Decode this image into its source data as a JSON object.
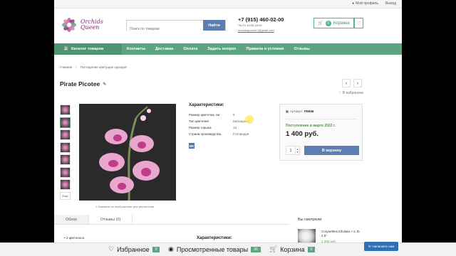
{
  "topbar": {
    "login": "Мой профиль",
    "exit": "Выход"
  },
  "logo": {
    "line1": "Orchids",
    "line2": "Queen"
  },
  "search": {
    "placeholder": "Поиск по товарам",
    "button": "Найти"
  },
  "contacts": {
    "phone": "+7 (915) 460-02-00",
    "hours": "Пн-Пт 10:00-18:00",
    "email": "orchidsqueen21@gmail.com"
  },
  "header_cart": {
    "count": "0",
    "label": "Корзина"
  },
  "nav": {
    "catalog": "Каталог товаров",
    "items": [
      "Контакты",
      "Доставка",
      "Оплата",
      "Задать вопрос",
      "Правила и условия",
      "Отзывы"
    ]
  },
  "breadcrumbs": [
    "Главная",
    "Поглядение цветущих орхидей"
  ],
  "product": {
    "title": "Pirate Picotee",
    "wishlist": "В избранное",
    "zoom_hint": "Нажмите на изображение для увеличения",
    "thumb_more": "Ещё"
  },
  "specs": {
    "title": "Характеристики:",
    "rows": [
      {
        "k": "Размер цветочка, см",
        "v": "8"
      },
      {
        "k": "Тип цветения",
        "v": "Каскадный"
      },
      {
        "k": "Размер горшка",
        "v": "12"
      },
      {
        "k": "Страна производства",
        "v": "Голландия"
      }
    ],
    "vk": "ВК"
  },
  "buy": {
    "sku_label": "Артикул:",
    "sku": "П5046",
    "arrival": "Поступление в марте 2022 г.",
    "price": "1 400 руб.",
    "qty": "1",
    "add": "В корзину"
  },
  "tabs": [
    "Обзор",
    "Отзывы (0)"
  ],
  "overview": {
    "chip": "• 2 цветоноса",
    "specs_title": "Характеристики:"
  },
  "seen": {
    "title": "Вы смотрели",
    "name": "Coryanthes trifoliata × s. tb 2,5\"",
    "price": "2 200 руб."
  },
  "bottombar": {
    "fav": "Избранное",
    "fav_count": "0",
    "viewed": "Просмотренные товары",
    "viewed_count": "30",
    "cart": "Корзина",
    "cart_count": "0",
    "write": "Напишите нам"
  }
}
